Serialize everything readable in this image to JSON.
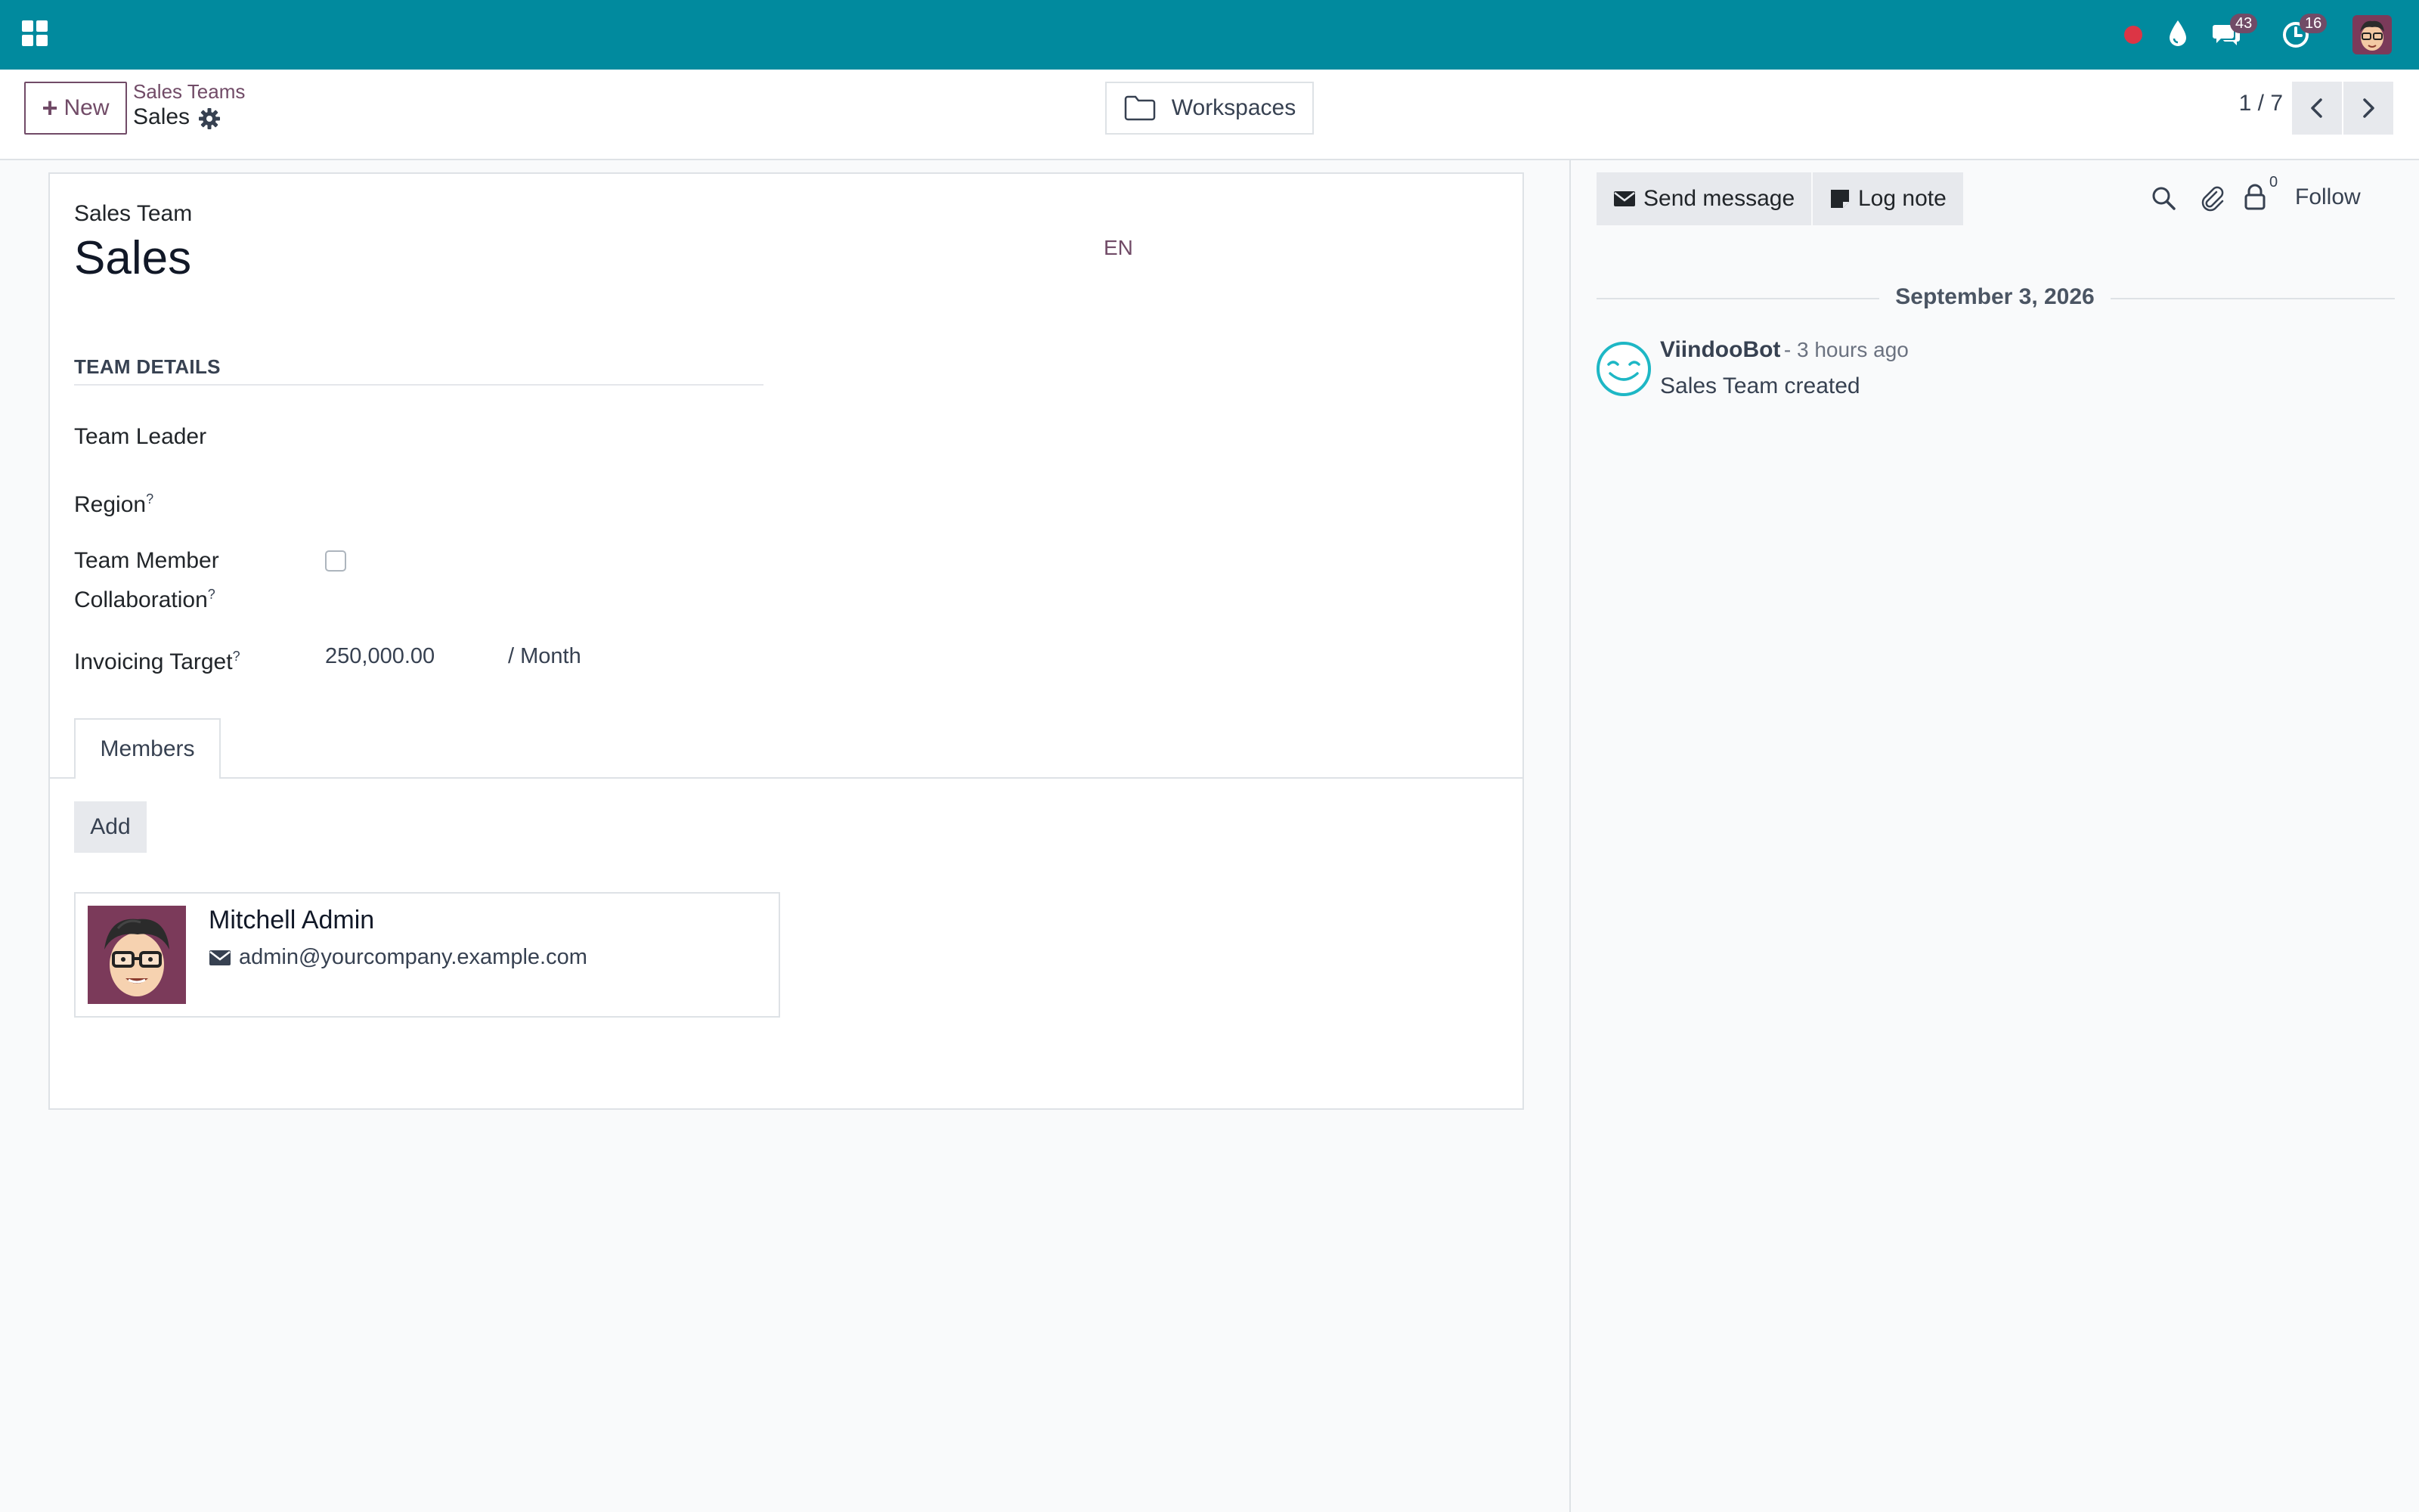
{
  "colors": {
    "navbar": "#018a9e",
    "brand": "#714b67",
    "badge": "#714b67",
    "status_red": "#dc3545",
    "bot": "#1eb7c5"
  },
  "navbar": {
    "icons": [
      "apps-icon",
      "status-dot-icon",
      "drop-icon",
      "chat-bubbles-icon",
      "activity-clock-icon",
      "user-avatar"
    ],
    "messages_badge": "43",
    "activities_badge": "16"
  },
  "control_panel": {
    "new_label": "New",
    "breadcrumb_parent": "Sales Teams",
    "breadcrumb_current": "Sales",
    "workspaces_label": "Workspaces",
    "pager": "1 / 7"
  },
  "form": {
    "model_label": "Sales Team",
    "record_name": "Sales",
    "lang": "EN",
    "group_title": "TEAM DETAILS",
    "fields": {
      "team_leader": {
        "label": "Team Leader",
        "value": ""
      },
      "region": {
        "label": "Region",
        "help": "?",
        "value": ""
      },
      "collab_line1": "Team Member",
      "collab_line2": "Collaboration",
      "collab_help": "?",
      "collab_checked": false,
      "invoicing": {
        "label": "Invoicing Target",
        "help": "?",
        "value": "250,000.00",
        "unit": "/ Month"
      }
    },
    "tabs": [
      {
        "label": "Members",
        "active": true
      }
    ],
    "add_label": "Add",
    "members": [
      {
        "name": "Mitchell Admin",
        "email": "admin@yourcompany.example.com"
      }
    ]
  },
  "chatter": {
    "send_message": "Send message",
    "log_note": "Log note",
    "followers_count": "0",
    "follow_label": "Follow",
    "date": "September 3, 2026",
    "messages": [
      {
        "author": "ViindooBot",
        "time": "- 3 hours ago",
        "body": "Sales Team created"
      }
    ]
  }
}
